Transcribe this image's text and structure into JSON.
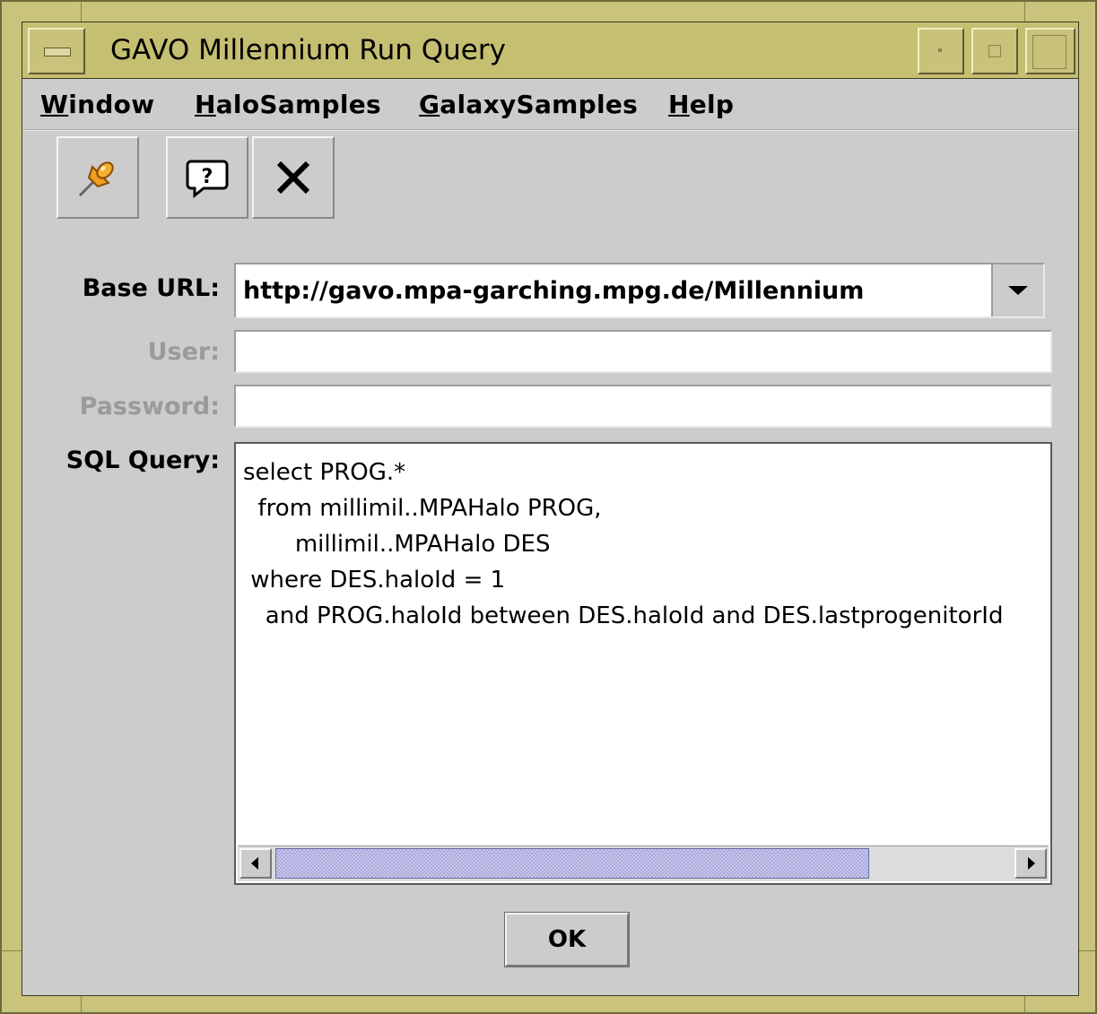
{
  "window": {
    "title": "GAVO Millennium Run Query"
  },
  "menubar": {
    "items": [
      {
        "label_mnemonic": "W",
        "label_rest": "indow"
      },
      {
        "label_mnemonic": "H",
        "label_rest": "aloSamples"
      },
      {
        "label_mnemonic": "G",
        "label_rest": "alaxySamples"
      },
      {
        "label_mnemonic": "H",
        "label_rest": "elp"
      }
    ]
  },
  "toolbar": {
    "buttons": [
      {
        "icon": "pushpin-icon"
      },
      {
        "icon": "help-icon"
      },
      {
        "icon": "close-icon"
      }
    ]
  },
  "form": {
    "base_url_label": "Base URL:",
    "base_url_value": "http://gavo.mpa-garching.mpg.de/Millennium",
    "user_label": "User:",
    "user_value": "",
    "password_label": "Password:",
    "password_value": "",
    "sql_label": "SQL Query:",
    "sql_value": "select PROG.*\n  from millimil..MPAHalo PROG,\n       millimil..MPAHalo DES\n where DES.haloId = 1\n   and PROG.haloId between DES.haloId and DES.lastprogenitorId"
  },
  "scrollbar": {
    "position_fraction": 0.0,
    "visible_fraction": 0.84
  },
  "ok_button": {
    "label": "OK"
  },
  "colors": {
    "frame": "#c9c37c",
    "panel": "#cccccc",
    "scroll_thumb": "#a9a9dd"
  }
}
